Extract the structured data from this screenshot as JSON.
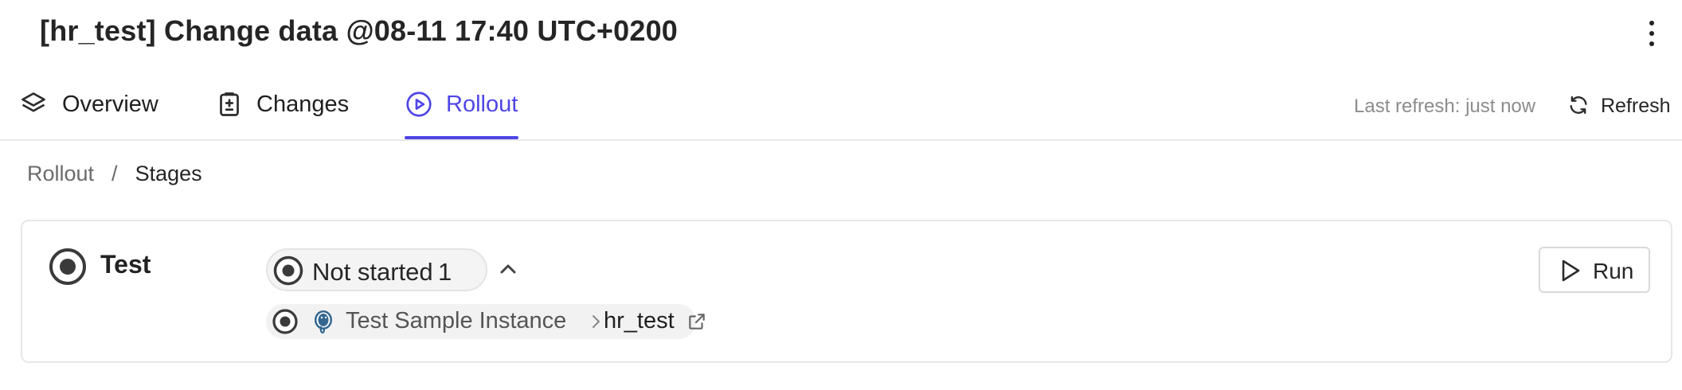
{
  "header": {
    "title": "[hr_test] Change data @08-11 17:40 UTC+0200",
    "more_icon": "more-vertical-icon"
  },
  "tabs": [
    {
      "label": "Overview",
      "icon": "layers-icon",
      "active": false
    },
    {
      "label": "Changes",
      "icon": "clipboard-diff-icon",
      "active": false
    },
    {
      "label": "Rollout",
      "icon": "play-circle-icon",
      "active": true
    }
  ],
  "toolbar": {
    "last_refresh": "Last refresh: just now",
    "refresh_label": "Refresh",
    "refresh_icon": "refresh-icon"
  },
  "breadcrumb": {
    "root": "Rollout",
    "separator": "/",
    "current": "Stages"
  },
  "stage": {
    "name": "Test",
    "status_icon": "not-started-status-icon",
    "status_label": "Not started",
    "status_count": "1",
    "collapse_icon": "chevron-up-icon",
    "run_label": "Run",
    "run_icon": "play-icon",
    "task": {
      "status_icon": "not-started-status-icon",
      "engine_icon": "postgresql-icon",
      "instance": "Test Sample Instance",
      "separator_icon": "chevron-right-icon",
      "database": "hr_test",
      "link_icon": "external-link-icon"
    }
  },
  "colors": {
    "accent": "#4f46e5",
    "muted_text": "#8c8c8c",
    "border": "#e6e6e6",
    "pill_bg": "#f4f4f4",
    "postgres_blue": "#336791"
  }
}
